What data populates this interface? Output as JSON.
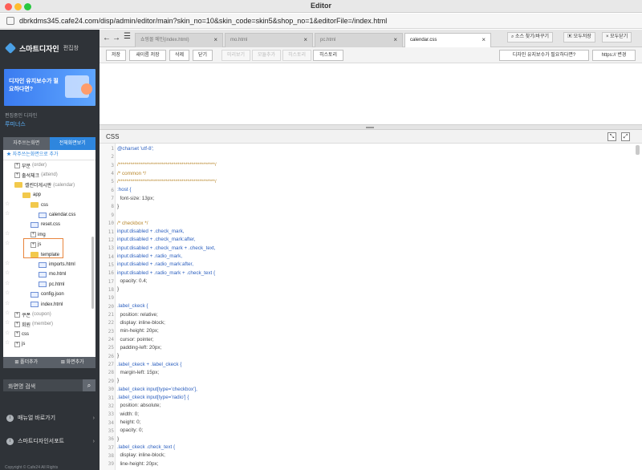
{
  "window": {
    "title": "Editor"
  },
  "browser": {
    "url": "dbrkdms345.cafe24.com/disp/admin/editor/main?skin_no=10&skin_code=skin5&shop_no=1&editorFile=/index.html"
  },
  "sidebar": {
    "brand": "스마트디자인",
    "brand_sub": "편집창",
    "banner_text": "디자인 유지보수가 필요하다면?",
    "editing_label": "편집중인 디자인",
    "editing_name": "루미너스",
    "tab_frequent": "자주쓰는화면",
    "tab_all": "전체화면보기",
    "favorite_add": "자주쓰는화면으로 추가",
    "tree": [
      {
        "label": "부분",
        "sub": "(order)",
        "type": "plus"
      },
      {
        "label": "출석체크",
        "sub": "(attend)",
        "type": "plus"
      },
      {
        "label": "캘린더게시판",
        "sub": "(calendar)",
        "type": "folder"
      },
      {
        "label": "app",
        "sub": "",
        "type": "folder"
      },
      {
        "label": "css",
        "sub": "",
        "type": "folder"
      },
      {
        "label": "calendar.css",
        "sub": "",
        "type": "file"
      },
      {
        "label": "reset.css",
        "sub": "",
        "type": "file"
      },
      {
        "label": "img",
        "sub": "",
        "type": "plus"
      },
      {
        "label": "js",
        "sub": "",
        "type": "plus"
      },
      {
        "label": "template",
        "sub": "",
        "type": "folder"
      },
      {
        "label": "imports.html",
        "sub": "",
        "type": "file"
      },
      {
        "label": "mo.html",
        "sub": "",
        "type": "file"
      },
      {
        "label": "pc.html",
        "sub": "",
        "type": "file"
      },
      {
        "label": "config.json",
        "sub": "",
        "type": "file"
      },
      {
        "label": "index.html",
        "sub": "",
        "type": "file"
      },
      {
        "label": "쿠폰",
        "sub": "(coupon)",
        "type": "plus"
      },
      {
        "label": "회원",
        "sub": "(member)",
        "type": "plus"
      },
      {
        "label": "css",
        "sub": "",
        "type": "plus"
      },
      {
        "label": "js",
        "sub": "",
        "type": "plus"
      }
    ],
    "add_folder": "폴더추가",
    "add_screen": "화면추가",
    "search_label": "화면명 검색",
    "links": [
      "매뉴얼 바로가기",
      "스마트디자인서포트"
    ],
    "copyright": "Copyright © Cafe24 All Rights"
  },
  "tabs": {
    "items": [
      {
        "label": "쇼핑몰 메인(index.html)",
        "active": false
      },
      {
        "label": "mo.html",
        "active": false
      },
      {
        "label": "pc.html",
        "active": false
      },
      {
        "label": "calendar.css",
        "active": true
      }
    ],
    "right_buttons": [
      "소스 찾기/바꾸기",
      "모두저장",
      "모두닫기"
    ]
  },
  "toolbar": {
    "buttons": [
      "저장",
      "새이름 저장",
      "삭제",
      "닫기"
    ],
    "disabled_buttons": [
      "미리보기",
      "모듈추가",
      "히스토리",
      "히스토리"
    ],
    "help_button": "디자인 유지보수가 필요하다면?",
    "https_button": "https:// 변경"
  },
  "editor": {
    "title": "CSS",
    "line_numbers": [
      "1",
      "2",
      "3",
      "4",
      "5",
      "6",
      "7",
      "8",
      "9",
      "10",
      "11",
      "12",
      "13",
      "14",
      "15",
      "16",
      "17",
      "18",
      "19",
      "20",
      "21",
      "22",
      "23",
      "24",
      "25",
      "26",
      "27",
      "28",
      "29",
      "30",
      "31",
      "32",
      "33",
      "34",
      "35",
      "36",
      "37",
      "38",
      "39"
    ],
    "lines": [
      "@charset 'utf-8';",
      "",
      "/*************************************************/",
      "/* common */",
      "/*************************************************/",
      ":host {",
      "  font-size: 13px;",
      "}",
      "",
      "/* checkbox */",
      "input:disabled + .check_mark,",
      "input:disabled + .check_mark:after,",
      "input:disabled + .check_mark + .check_text,",
      "input:disabled + .radio_mark,",
      "input:disabled + .radio_mark:after,",
      "input:disabled + .radio_mark + .check_text {",
      "  opacity: 0.4;",
      "}",
      "",
      ".label_ckeck {",
      "  position: relative;",
      "  display: inline-block;",
      "  min-height: 20px;",
      "  cursor: pointer;",
      "  padding-left: 20px;",
      "}",
      ".label_ckeck + .label_ckeck {",
      "  margin-left: 15px;",
      "}",
      ".label_ckeck input[type='checkbox'],",
      ".label_ckeck input[type='radio'] {",
      "  position: absolute;",
      "  width: 0;",
      "  height: 0;",
      "  opacity: 0;",
      "}",
      ".label_ckeck .check_text {",
      "  display: inline-block;",
      "  line-height: 20px;"
    ]
  }
}
